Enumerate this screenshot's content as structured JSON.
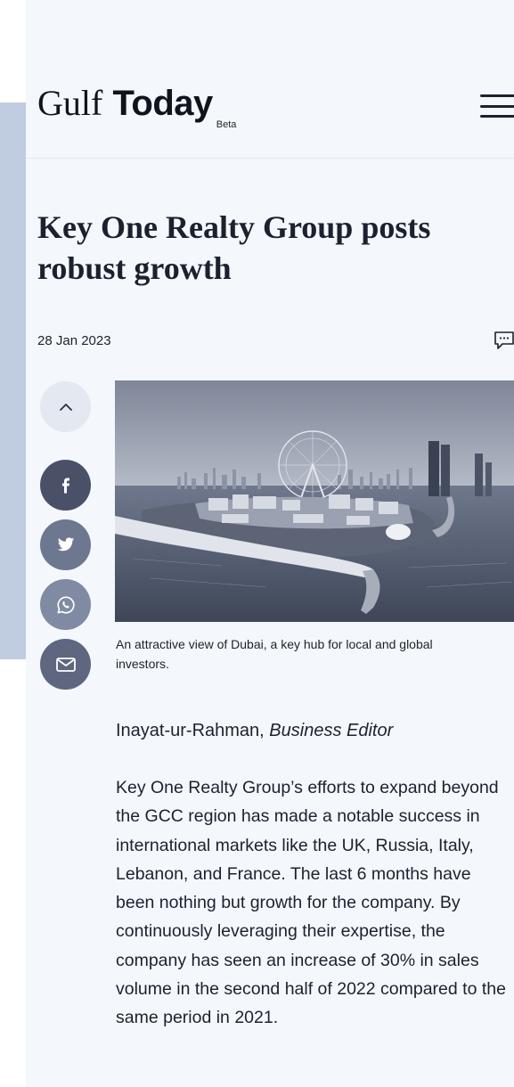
{
  "header": {
    "logo_gulf": "Gulf",
    "logo_today": "Today",
    "logo_beta": "Beta"
  },
  "article": {
    "title": "Key One Realty Group posts robust growth",
    "date": "28 Jan 2023",
    "caption_line1": "An attractive view of Dubai, a key hub for local and global",
    "caption_line2": "investors.",
    "author_name": "Inayat-ur-Rahman, ",
    "author_role": "Business Editor",
    "body": "Key One Realty Group’s efforts to expand beyond the GCC region has made a notable success in international markets like the UK, Russia, Italy, Lebanon, and France. The last 6 months have been nothing but growth for the company. By continuously leveraging their expertise, the company has seen an increase of 30% in sales volume in the second half of 2022 compared to the same period in 2021."
  },
  "icons": {
    "menu": "hamburger-menu-icon",
    "comment": "comment-icon",
    "scroll_up": "chevron-up-icon",
    "facebook": "facebook-icon",
    "twitter": "twitter-icon",
    "whatsapp": "whatsapp-icon",
    "email": "mail-icon"
  },
  "colors": {
    "page_background": "#f4f8fc",
    "side_panel": "#c0cce0",
    "text": "#1c2130",
    "facebook_button": "#4a5068",
    "twitter_button": "#6e7790",
    "whatsapp_button": "#808aa2",
    "email_button": "#5e6680"
  }
}
